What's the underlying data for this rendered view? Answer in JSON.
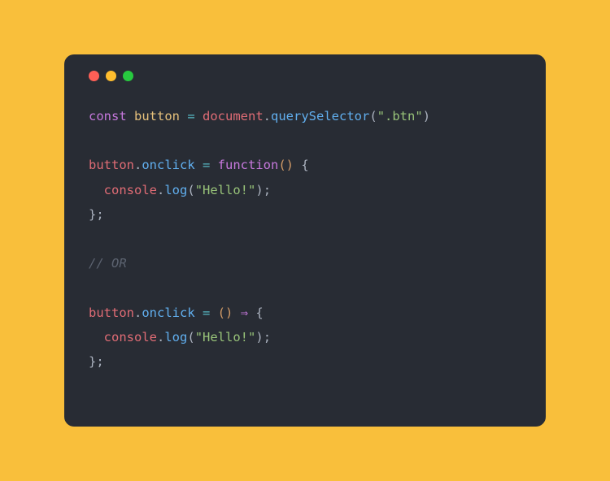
{
  "code": {
    "line1": {
      "const": "const",
      "button": "button",
      "eq": " = ",
      "document": "document",
      "dot1": ".",
      "querySelector": "querySelector",
      "lparen": "(",
      "string": "\".btn\"",
      "rparen": ")"
    },
    "line3": {
      "button": "button",
      "dot": ".",
      "onclick": "onclick",
      "eq": " = ",
      "function": "function",
      "parens": "()",
      "space": " ",
      "lbrace": "{"
    },
    "line4": {
      "indent": "  ",
      "console": "console",
      "dot": ".",
      "log": "log",
      "lparen": "(",
      "string": "\"Hello!\"",
      "rparen": ")",
      "semi": ";"
    },
    "line5": {
      "rbrace": "}",
      "semi": ";"
    },
    "line7": {
      "comment": "// OR"
    },
    "line9": {
      "button": "button",
      "dot": ".",
      "onclick": "onclick",
      "eq": " = ",
      "lparen": "(",
      "rparen": ")",
      "space1": " ",
      "arrow": "⇒",
      "space2": " ",
      "lbrace": "{"
    },
    "line10": {
      "indent": "  ",
      "console": "console",
      "dot": ".",
      "log": "log",
      "lparen": "(",
      "string": "\"Hello!\"",
      "rparen": ")",
      "semi": ";"
    },
    "line11": {
      "rbrace": "}",
      "semi": ";"
    }
  }
}
